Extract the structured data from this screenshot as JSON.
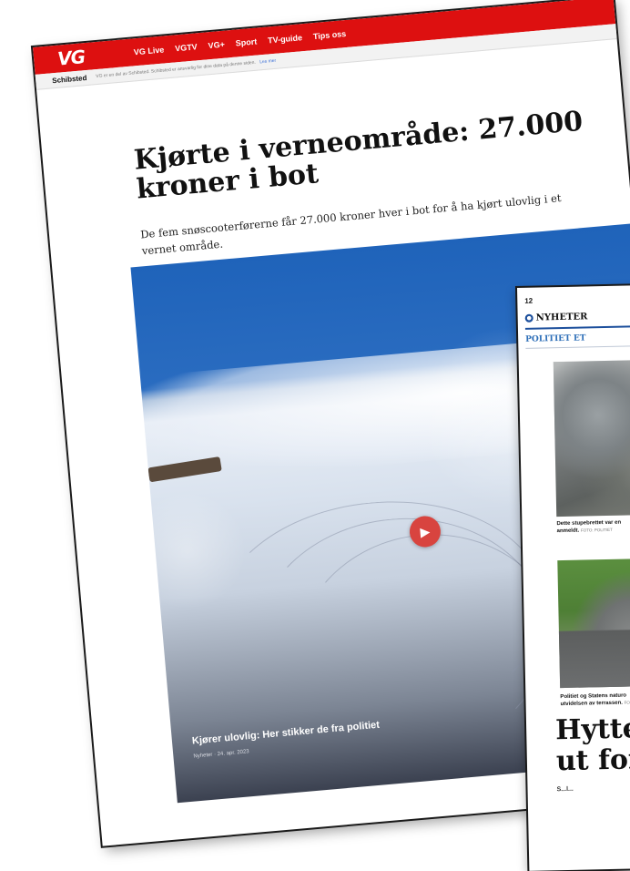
{
  "web": {
    "logo": "VG",
    "nav": [
      "VG Live",
      "VGTV",
      "VG+",
      "Sport",
      "TV-guide",
      "Tips oss"
    ],
    "schibsted": {
      "logo": "Schibsted",
      "notice": "VG er en del av Schibsted. Schibsted er ansvarlig for dine data på denne siden.",
      "read_more": "Les mer"
    },
    "headline": "Kjørte i verneområde: 27.000 kroner i bot",
    "lead": "De fem snøscooterførerne får 27.000 kroner hver i bot for å ha kjørt ulovlig i et vernet område.",
    "video": {
      "title": "Kjører ulovlig: Her stikker de fra politiet",
      "meta": "Nyheter · 24. apr. 2023",
      "play_icon": "play-icon"
    }
  },
  "newspaper": {
    "page_number": "12",
    "section": "NYHETER",
    "kicker": "POLITIET ET",
    "caption1": {
      "text": "Dette stupebrettet var en",
      "text2": "anmeldt.",
      "credit": "FOTO: POLITIET"
    },
    "caption2": {
      "text": "Politiet og Statens naturo",
      "text2": "utvidelsen av terrassen.",
      "credit": "FO"
    },
    "headline_line1": "Hyttee",
    "headline_line2": "ut for u",
    "body_fragment": "S...l..."
  },
  "colors": {
    "vg_red": "#dd1010",
    "newspaper_blue": "#1c4f9c",
    "kicker_blue": "#2e6fb8",
    "play_red": "#d8443f"
  }
}
